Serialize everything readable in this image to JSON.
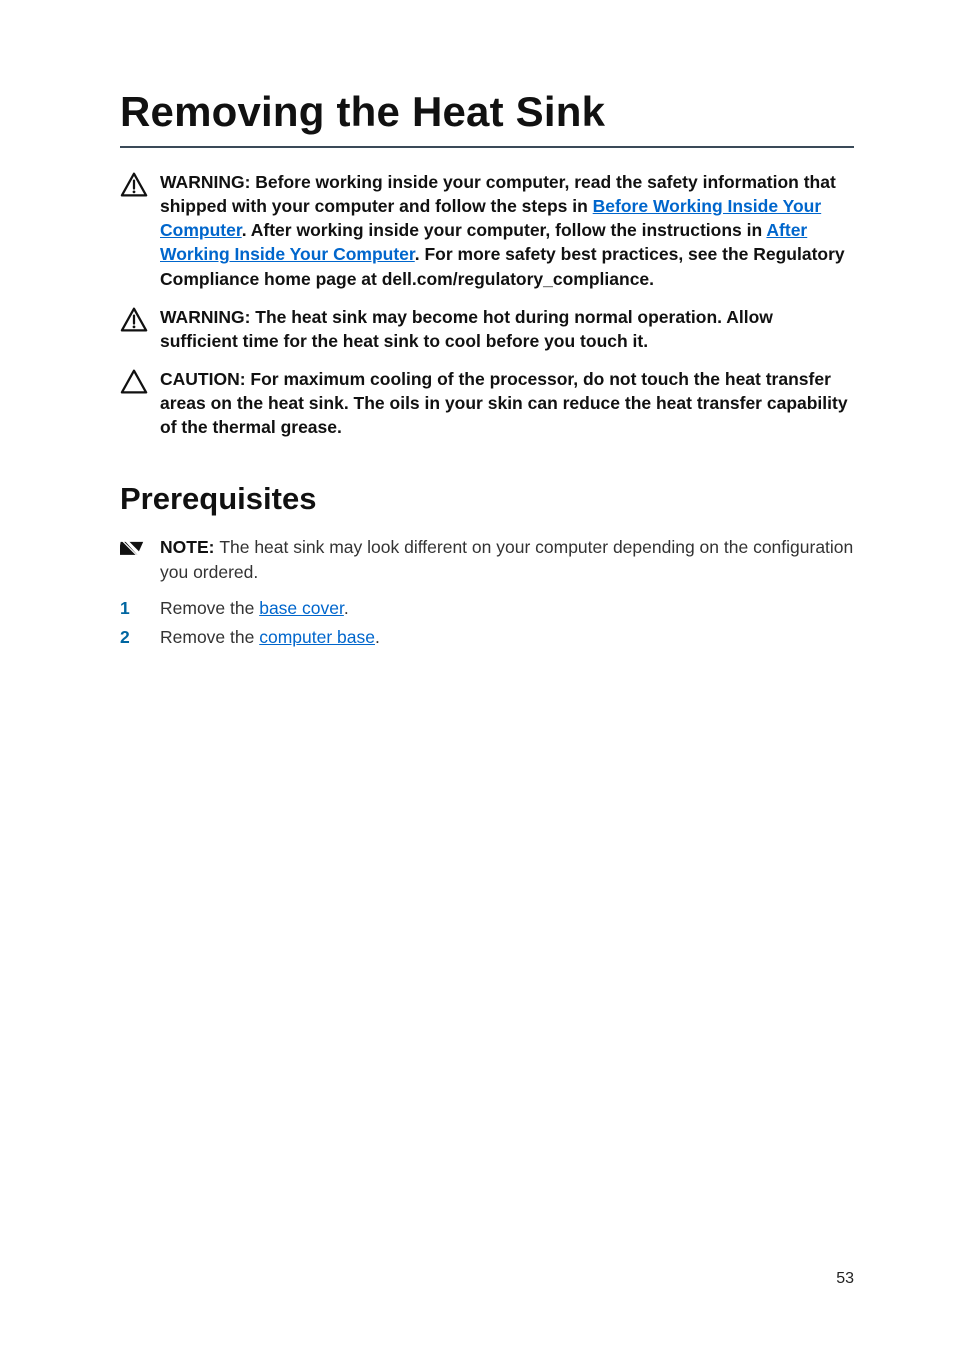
{
  "title": "Removing the Heat Sink",
  "warn1": {
    "t1": "WARNING: Before working inside your computer, read the safety information that shipped with your computer and follow the steps in ",
    "l1": "Before Working Inside Your Computer",
    "t2": ". After working inside your computer, follow the instructions in ",
    "l2": "After Working Inside Your Computer",
    "t3": ". For more safety best practices, see the Regulatory Compliance home page at dell.com/regulatory_compliance."
  },
  "warn2": "WARNING: The heat sink may become hot during normal operation. Allow sufficient time for the heat sink to cool before you touch it.",
  "caution": "CAUTION: For maximum cooling of the processor, do not touch the heat transfer areas on the heat sink. The oils in your skin can reduce the heat transfer capability of the thermal grease.",
  "section": "Prerequisites",
  "note": {
    "lead": "NOTE: ",
    "body": "The heat sink may look different on your computer depending on the configuration you ordered."
  },
  "steps": [
    {
      "n": "1",
      "pre": "Remove the ",
      "link": "base cover",
      "post": "."
    },
    {
      "n": "2",
      "pre": "Remove the ",
      "link": "computer base",
      "post": "."
    }
  ],
  "pagenum": "53"
}
